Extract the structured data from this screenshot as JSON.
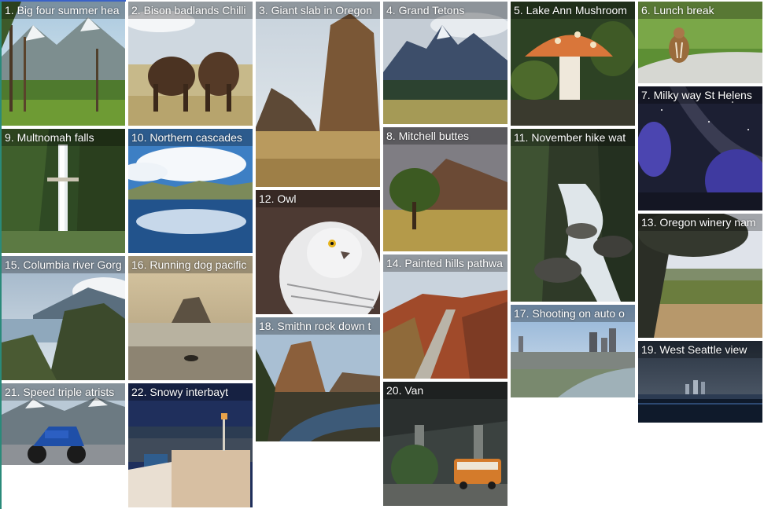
{
  "gallery": {
    "tiles": [
      {
        "caption": "1. Big four summer hea"
      },
      {
        "caption": "2. Bison badlands Chilli"
      },
      {
        "caption": "3. Giant slab in Oregon"
      },
      {
        "caption": "4. Grand Tetons"
      },
      {
        "caption": "5. Lake Ann Mushroom"
      },
      {
        "caption": "6. Lunch break"
      },
      {
        "caption": "7. Milky way St Helens"
      },
      {
        "caption": "8. Mitchell buttes"
      },
      {
        "caption": "9. Multnomah falls"
      },
      {
        "caption": "10. Northern cascades"
      },
      {
        "caption": "11. November hike wat"
      },
      {
        "caption": "12. Owl"
      },
      {
        "caption": "13. Oregon winery nam"
      },
      {
        "caption": "14. Painted hills pathwa"
      },
      {
        "caption": "15. Columbia river Gorg"
      },
      {
        "caption": "16. Running dog pacific"
      },
      {
        "caption": "17. Shooting on auto o"
      },
      {
        "caption": "18. Smithn rock down t"
      },
      {
        "caption": "19. West Seattle view"
      },
      {
        "caption": "20. Van"
      },
      {
        "caption": "21. Speed triple atrists"
      },
      {
        "caption": "22. Snowy interbayt"
      }
    ]
  }
}
